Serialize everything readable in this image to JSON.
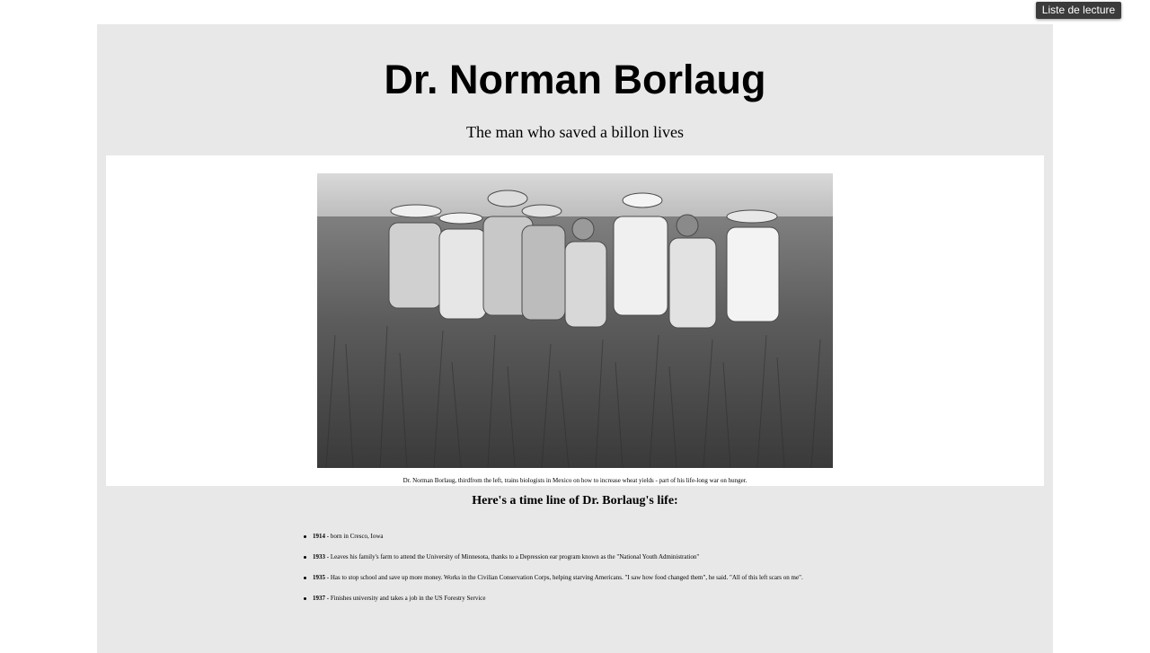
{
  "toolbar": {
    "reading_list_label": "Liste de lecture"
  },
  "page": {
    "title": "Dr. Norman Borlaug",
    "subtitle": "The man who saved a billon lives",
    "image": {
      "description_icon": "photo-wheat-field-group",
      "caption": "Dr. Norman Borlaug, thirdfrom the left, trains biologists in Mexico on how to increase wheat yields - part of his life-long war on hunger."
    },
    "timeline_heading": "Here's a time line of Dr. Borlaug's life:",
    "timeline": [
      {
        "year": "1914",
        "text": " - born in Cresco, Iowa"
      },
      {
        "year": "1933",
        "text": " - Leaves his family's farm to attend the University of Minnesota, thanks to a Depression ear program known as the \"National Youth Administration\""
      },
      {
        "year": "1935",
        "text": " - Has to stop school and save up more money. Works in the Civilian Conservation Corps, helping starving Americans. \"I saw how food changed them\", he said. \"All of this left scars on me\"."
      },
      {
        "year": "1937",
        "text": " - Finishes university and takes a job in the US Forestry Service"
      }
    ]
  },
  "colors": {
    "main_bg": "#e8e8e8",
    "image_panel_bg": "#ffffff",
    "reading_list_bg": "#3b3b3b"
  }
}
